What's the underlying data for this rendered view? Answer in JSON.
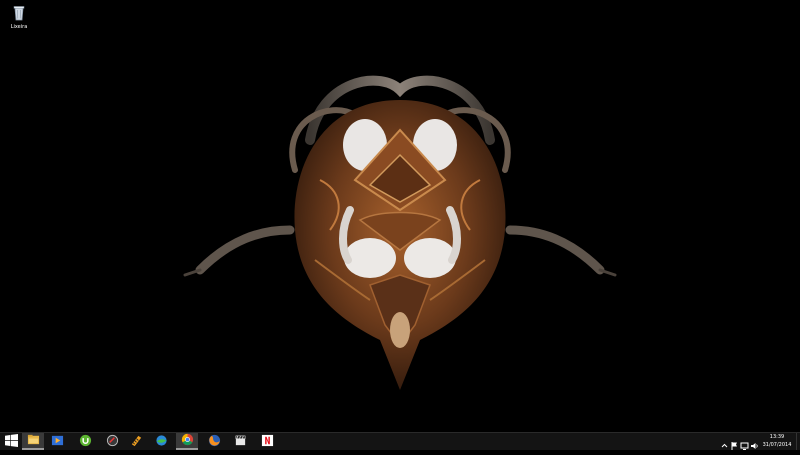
{
  "desktop": {
    "icons": [
      {
        "label": "Lixeira",
        "icon": "recycle-bin-icon"
      }
    ],
    "wallpaper": "symmetric-driftwood-mandala"
  },
  "taskbar": {
    "start_icon": "windows-logo-icon",
    "pinned": [
      {
        "icon": "file-explorer-icon",
        "active": true
      },
      {
        "icon": "media-player-icon",
        "active": false
      },
      {
        "icon": "utorrent-icon",
        "active": false
      },
      {
        "icon": "unknown-app-icon",
        "active": false
      },
      {
        "icon": "video-editor-icon",
        "active": false
      },
      {
        "icon": "green-globe-app-icon",
        "active": false
      },
      {
        "icon": "chrome-icon",
        "active": true
      },
      {
        "icon": "firefox-icon",
        "active": false
      },
      {
        "icon": "clapperboard-icon",
        "active": false
      },
      {
        "icon": "netflix-icon",
        "active": false
      }
    ],
    "tray": {
      "icons": [
        "show-hidden-icons-chevron",
        "action-center-flag-icon",
        "network-icon",
        "volume-icon"
      ],
      "time": "13:39",
      "date": "31/07/2014"
    }
  }
}
